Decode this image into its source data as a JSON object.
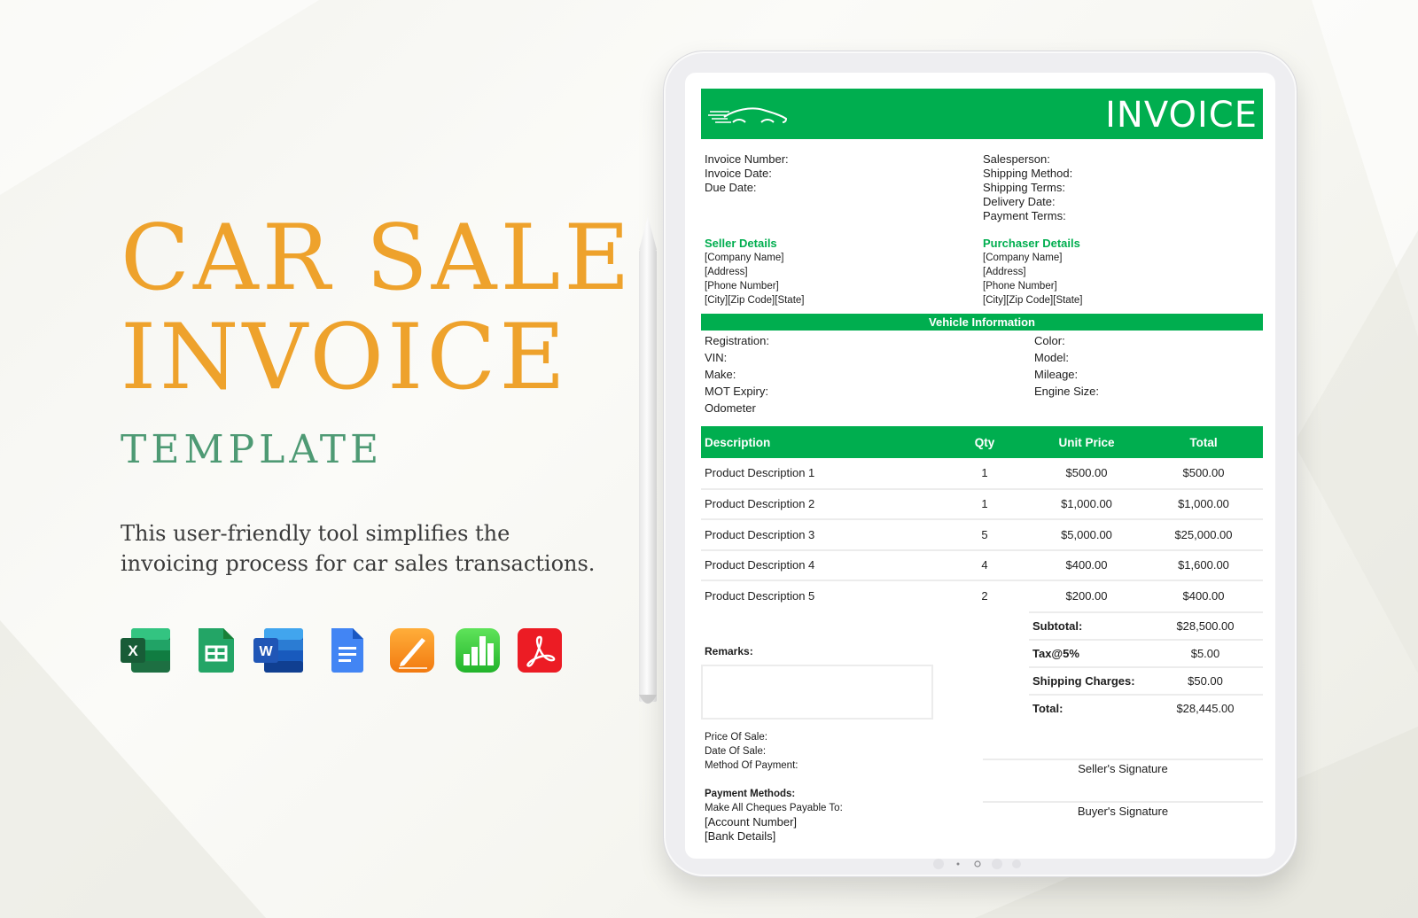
{
  "colors": {
    "accent_green": "#00ae4f",
    "title_orange": "#eea22c",
    "subtitle_green": "#4e9a74",
    "text_dark": "#1d1d1d"
  },
  "promo": {
    "title_line1": "CAR SALE",
    "title_line2": "INVOICE",
    "subtitle": "TEMPLATE",
    "description": "This user-friendly tool simplifies the invoicing process for car sales transactions.",
    "formats": [
      {
        "name": "microsoft-excel",
        "icon": "excel-icon",
        "glyph": "X"
      },
      {
        "name": "google-sheets",
        "icon": "google-sheets-icon",
        "glyph": ""
      },
      {
        "name": "microsoft-word",
        "icon": "word-icon",
        "glyph": "W"
      },
      {
        "name": "google-docs",
        "icon": "google-docs-icon",
        "glyph": ""
      },
      {
        "name": "apple-pages",
        "icon": "pages-icon",
        "glyph": ""
      },
      {
        "name": "apple-numbers",
        "icon": "numbers-icon",
        "glyph": ""
      },
      {
        "name": "adobe-pdf",
        "icon": "pdf-icon",
        "glyph": ""
      }
    ]
  },
  "invoice": {
    "logo_icon": "car-icon",
    "title": "INVOICE",
    "meta_left": [
      "Invoice Number:",
      "Invoice Date:",
      "Due Date:"
    ],
    "meta_right": [
      "Salesperson:",
      "Shipping Method:",
      "Shipping Terms:",
      "Delivery Date:",
      "Payment Terms:"
    ],
    "seller": {
      "heading": "Seller Details",
      "lines": [
        "[Company Name]",
        "[Address]",
        "[Phone Number]",
        "[City][Zip Code][State]"
      ]
    },
    "purchaser": {
      "heading": "Purchaser Details",
      "lines": [
        "[Company Name]",
        "[Address]",
        "[Phone Number]",
        "[City][Zip Code][State]"
      ]
    },
    "vehicle": {
      "heading": "Vehicle Information",
      "left": [
        "Registration:",
        "VIN:",
        "Make:",
        "MOT Expiry:",
        "Odometer"
      ],
      "right": [
        "Color:",
        "Model:",
        "Mileage:",
        "Engine Size:"
      ]
    },
    "items": {
      "headers": [
        "Description",
        "Qty",
        "Unit Price",
        "Total"
      ],
      "rows": [
        [
          "Product Description 1",
          "1",
          "$500.00",
          "$500.00"
        ],
        [
          "Product Description 2",
          "1",
          "$1,000.00",
          "$1,000.00"
        ],
        [
          "Product Description 3",
          "5",
          "$5,000.00",
          "$25,000.00"
        ],
        [
          "Product Description 4",
          "4",
          "$400.00",
          "$1,600.00"
        ],
        [
          "Product Description 5",
          "2",
          "$200.00",
          "$400.00"
        ]
      ]
    },
    "totals": [
      {
        "label": "Subtotal:",
        "value": "$28,500.00"
      },
      {
        "label": "Tax@5%",
        "value": "$5.00"
      },
      {
        "label": "Shipping Charges:",
        "value": "$50.00"
      },
      {
        "label": "Total:",
        "value": "$28,445.00"
      }
    ],
    "remarks_label": "Remarks:",
    "sale_info": [
      "Price Of Sale:",
      "Date Of Sale:",
      "Method Of Payment:"
    ],
    "payment": {
      "heading": "Payment Methods:",
      "cheques": "Make All Cheques Payable To:",
      "account": "[Account Number]",
      "bank": "[Bank Details]"
    },
    "seller_signature": "Seller's Signature",
    "buyer_signature": "Buyer's Signature"
  }
}
